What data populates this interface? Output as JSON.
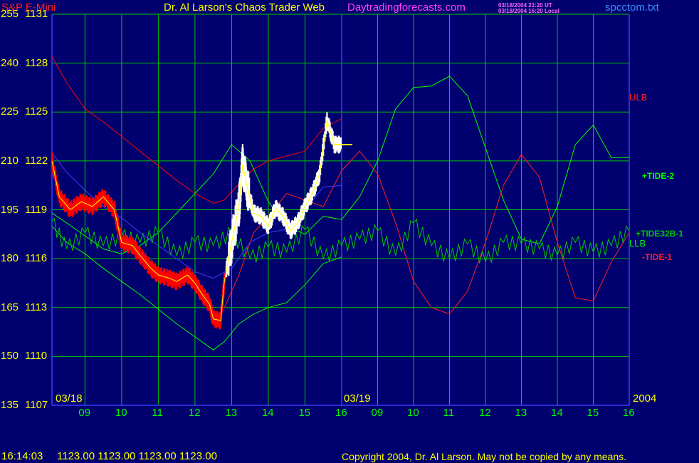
{
  "header": {
    "symbol": "S&P E-Mini",
    "title": "Dr. Al Larson's Chaos Trader Web",
    "site": "Daytradingforecasts.com",
    "ts_ut": "03/18/2004 21:20 UT",
    "ts_local": "03/18/2004 16:20 Local",
    "file": "spcctom.txt"
  },
  "footer": {
    "time": "16:14:03",
    "quote": "1123.00 1123.00 1123.00 1123.00",
    "copyright": "Copyright 2004, Dr. Al Larson. May not be copied by any means."
  },
  "colors": {
    "background": "#00006e",
    "grid": "#00c800",
    "axis_text": "#ffff00",
    "hour_text": "#00ff00",
    "price_up": "#ffffff",
    "price_down": "#ff0000",
    "ma": "#ffff00",
    "blue_line": "#3c3cff",
    "ulb": "#ff0000",
    "tide2": "#00ff00",
    "tide32b": "#00c800",
    "tide1": "#ff2020"
  },
  "chart_data": {
    "type": "line",
    "title": "S&P E-Mini",
    "y_left_labels": [
      "255",
      "240",
      "225",
      "210",
      "195",
      "180",
      "165",
      "150",
      "135"
    ],
    "y_right_labels": [
      "1131",
      "1128",
      "1125",
      "1122",
      "1119",
      "1116",
      "1113",
      "1110",
      "1107"
    ],
    "ylim": [
      1107,
      1131
    ],
    "y_grid_step": 3,
    "x_hours": [
      "09",
      "10",
      "11",
      "12",
      "13",
      "14",
      "15",
      "16",
      "09",
      "10",
      "11",
      "12",
      "13",
      "14",
      "15",
      "16"
    ],
    "date_markers": [
      "03/18",
      "03/19"
    ],
    "year_label": "2004",
    "line_labels": {
      "ulb": "ULB",
      "tide2": "+TIDE-2",
      "tide32b": "+TIDE32B-1",
      "llb": "LLB",
      "tide1": "-TIDE-1"
    },
    "series": [
      {
        "name": "ULB",
        "x": [
          8.1,
          8.5,
          9.0,
          9.5,
          10.0,
          10.5,
          11.0,
          11.5,
          12.0,
          12.5,
          12.8,
          13.2,
          13.6,
          14.0,
          14.5,
          15.0,
          15.5,
          16.0
        ],
        "y": [
          1128.4,
          1126.8,
          1125.2,
          1124.4,
          1123.5,
          1122.6,
          1121.7,
          1120.8,
          1120.0,
          1119.4,
          1119.6,
          1120.6,
          1121.5,
          1122.0,
          1122.3,
          1122.6,
          1124.0,
          1124.6
        ]
      },
      {
        "name": "LLB",
        "x": [
          8.1,
          8.5,
          9.0,
          9.5,
          10.0,
          10.5,
          11.0,
          11.5,
          12.0,
          12.5,
          12.8,
          13.2,
          13.6,
          14.0,
          14.5,
          15.0,
          15.5,
          16.0
        ],
        "y": [
          1118.0,
          1117.0,
          1116.3,
          1115.4,
          1114.6,
          1113.8,
          1112.9,
          1112.0,
          1111.2,
          1110.4,
          1110.9,
          1112.0,
          1112.6,
          1113.0,
          1113.3,
          1114.4,
          1115.7,
          1116.1
        ]
      },
      {
        "name": "+TIDE-2",
        "x": [
          8.1,
          8.5,
          9.0,
          9.5,
          10.0,
          10.5,
          11.0,
          11.5,
          12.0,
          12.5,
          13.0,
          13.5,
          14.0,
          14.5,
          15.0,
          15.5,
          16.0,
          16.5,
          17.0,
          17.5,
          18.0,
          18.5,
          19.0,
          19.5,
          20.0,
          20.5,
          21.0,
          21.5,
          22.0,
          22.5,
          23.0,
          23.5,
          24.0
        ],
        "y": [
          1118.8,
          1118.2,
          1117.4,
          1116.6,
          1116.3,
          1116.8,
          1117.6,
          1118.8,
          1120.0,
          1121.2,
          1123.0,
          1122.0,
          1119.5,
          1118.0,
          1117.5,
          1118.6,
          1118.4,
          1119.8,
          1122.0,
          1125.2,
          1126.5,
          1126.6,
          1127.2,
          1126.0,
          1122.8,
          1119.6,
          1117.2,
          1116.9,
          1119.2,
          1123.0,
          1124.2,
          1122.2,
          1122.2
        ]
      },
      {
        "name": "-TIDE-1",
        "x": [
          12.8,
          13.2,
          13.6,
          14.0,
          14.5,
          15.0,
          15.5,
          16.0,
          16.5,
          17.0,
          17.5,
          18.0,
          18.5,
          19.0,
          19.5,
          20.0,
          20.5,
          21.0,
          21.5,
          22.0,
          22.5,
          23.0,
          23.5,
          24.0
        ],
        "y": [
          1113.0,
          1115.0,
          1117.6,
          1118.6,
          1120.0,
          1119.6,
          1119.2,
          1121.4,
          1122.6,
          1121.2,
          1118.2,
          1114.6,
          1113.0,
          1112.6,
          1114.0,
          1117.0,
          1120.5,
          1122.4,
          1121.0,
          1117.0,
          1113.6,
          1113.4,
          1115.8,
          1117.6
        ]
      },
      {
        "name": "+TIDE32B-1",
        "x": [
          8.1,
          8.5,
          9.0,
          9.5,
          10.0,
          10.5,
          11.0,
          11.5,
          12.0,
          12.5,
          13.0,
          13.5,
          14.0,
          14.5,
          15.0,
          15.5,
          16.0,
          16.5,
          17.0,
          17.5,
          18.0,
          18.5,
          19.0,
          19.5,
          20.0,
          20.5,
          21.0,
          21.5,
          22.0,
          22.5,
          23.0,
          23.5,
          24.0
        ],
        "y": [
          1118.3,
          1116.6,
          1117.6,
          1116.8,
          1117.4,
          1117.0,
          1117.6,
          1116.2,
          1117.0,
          1116.8,
          1117.6,
          1116.0,
          1116.7,
          1116.4,
          1117.8,
          1116.0,
          1116.8,
          1117.2,
          1117.7,
          1116.2,
          1118.2,
          1116.8,
          1116.0,
          1116.9,
          1115.8,
          1117.0,
          1116.9,
          1116.6,
          1116.2,
          1117.0,
          1116.4,
          1116.8,
          1117.7
        ]
      },
      {
        "name": "blue",
        "x": [
          8.1,
          8.5,
          9.0,
          9.5,
          10.0,
          10.5,
          11.0,
          11.5,
          12.0,
          12.5,
          13.0,
          13.5,
          14.0,
          14.5,
          15.0,
          15.5,
          16.0
        ],
        "y": [
          1122.5,
          1121.3,
          1120.2,
          1119.2,
          1118.5,
          1117.6,
          1116.8,
          1116.0,
          1115.2,
          1114.8,
          1115.4,
          1117.0,
          1117.6,
          1117.8,
          1119.0,
          1120.4,
          1120.5
        ]
      },
      {
        "name": "price",
        "x": [
          8.1,
          8.3,
          8.6,
          8.9,
          9.2,
          9.5,
          9.8,
          10.0,
          10.3,
          10.5,
          10.8,
          11.0,
          11.3,
          11.5,
          11.8,
          12.0,
          12.2,
          12.4,
          12.5,
          12.7,
          12.8,
          13.0,
          13.2,
          13.3,
          13.4,
          13.6,
          13.8,
          14.0,
          14.2,
          14.4,
          14.6,
          14.8,
          15.0,
          15.2,
          15.4,
          15.6,
          15.8,
          16.0
        ],
        "y": [
          1122.0,
          1119.8,
          1119.0,
          1119.5,
          1119.2,
          1119.8,
          1119.0,
          1117.0,
          1116.8,
          1116.2,
          1115.4,
          1115.0,
          1114.8,
          1114.6,
          1115.0,
          1114.5,
          1113.8,
          1113.2,
          1112.3,
          1112.2,
          1114.6,
          1117.0,
          1119.2,
          1121.8,
          1120.6,
          1118.8,
          1118.6,
          1118.0,
          1119.1,
          1118.6,
          1117.7,
          1118.2,
          1119.2,
          1120.0,
          1121.2,
          1124.5,
          1123.0,
          1123.0
        ]
      }
    ]
  }
}
